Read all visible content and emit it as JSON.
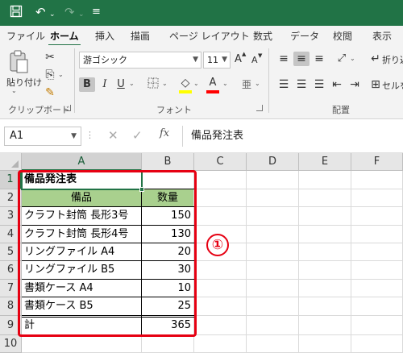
{
  "qat": {
    "save_icon": "save-icon",
    "undo_icon": "undo-icon",
    "redo_icon": "redo-icon",
    "customize_icon": "customize-qat-icon"
  },
  "menu": {
    "tabs": [
      "ファイル",
      "ホーム",
      "挿入",
      "描画",
      "ページ レイアウト",
      "数式",
      "データ",
      "校閲",
      "表示"
    ],
    "active": "ホーム"
  },
  "ribbon": {
    "clipboard": {
      "paste_label": "貼り付け",
      "group_label": "クリップボード"
    },
    "font": {
      "font_name": "游ゴシック",
      "font_size": "11",
      "bold": "B",
      "italic": "I",
      "underline": "U",
      "font_color_letter": "A",
      "grow_font": "A",
      "shrink_font": "A",
      "group_label": "フォント",
      "font_color": "#ff0000",
      "fill_color": "#ffff00"
    },
    "alignment": {
      "wrap_label": "折り返",
      "merge_label": "セルを",
      "group_label": "配置"
    }
  },
  "formula_bar": {
    "name_box": "A1",
    "fx": "fx",
    "formula": "備品発注表"
  },
  "sheet": {
    "columns": [
      "A",
      "B",
      "C",
      "D",
      "E",
      "F"
    ],
    "rows": [
      "1",
      "2",
      "3",
      "4",
      "5",
      "6",
      "7",
      "8",
      "9",
      "10"
    ],
    "title": "備品発注表",
    "header": {
      "item": "備品",
      "qty": "数量"
    },
    "items": [
      {
        "name": "クラフト封筒 長形3号",
        "qty": "150"
      },
      {
        "name": "クラフト封筒 長形4号",
        "qty": "130"
      },
      {
        "name": "リングファイル A4",
        "qty": "20"
      },
      {
        "name": "リングファイル B5",
        "qty": "30"
      },
      {
        "name": "書類ケース A4",
        "qty": "10"
      },
      {
        "name": "書類ケース B5",
        "qty": "25"
      }
    ],
    "total": {
      "label": "計",
      "qty": "365"
    },
    "header_fill": "#a9d08e",
    "accent": "#217346"
  },
  "annotation": {
    "callout": "①",
    "highlight_color": "#e60012"
  }
}
